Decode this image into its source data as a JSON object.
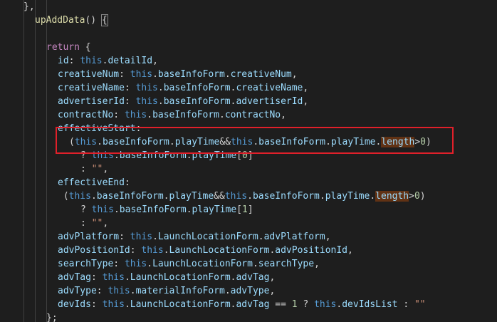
{
  "editor": {
    "colors": {
      "background": "#1e1e1e",
      "function": "#dcdcaa",
      "keyword": "#c586c0",
      "this": "#569cd6",
      "property": "#9cdcfe",
      "number": "#b5cea8",
      "string": "#ce9178",
      "punctuation": "#d4d4d4",
      "highlight_box": "#e0202a",
      "search_match": "#613214"
    },
    "lines": [
      {
        "indent": 0,
        "tokens": [
          {
            "t": "},",
            "c": "punc"
          }
        ]
      },
      {
        "indent": 1,
        "tokens": [
          {
            "t": "upAddData",
            "c": "fn"
          },
          {
            "t": "() ",
            "c": "punc"
          },
          {
            "t": "{",
            "c": "punc",
            "m": "brace-match"
          }
        ]
      },
      {
        "indent": 0,
        "tokens": []
      },
      {
        "indent": 2,
        "tokens": [
          {
            "t": "return",
            "c": "kw"
          },
          {
            "t": " {",
            "c": "punc"
          }
        ]
      },
      {
        "indent": 3,
        "tokens": [
          {
            "t": "id",
            "c": "prop"
          },
          {
            "t": ": ",
            "c": "punc"
          },
          {
            "t": "this",
            "c": "self"
          },
          {
            "t": ".",
            "c": "punc"
          },
          {
            "t": "detailId",
            "c": "prop"
          },
          {
            "t": ",",
            "c": "punc"
          }
        ]
      },
      {
        "indent": 3,
        "tokens": [
          {
            "t": "creativeNum",
            "c": "prop"
          },
          {
            "t": ": ",
            "c": "punc"
          },
          {
            "t": "this",
            "c": "self"
          },
          {
            "t": ".",
            "c": "punc"
          },
          {
            "t": "baseInfoForm",
            "c": "prop"
          },
          {
            "t": ".",
            "c": "punc"
          },
          {
            "t": "creativeNum",
            "c": "prop"
          },
          {
            "t": ",",
            "c": "punc"
          }
        ]
      },
      {
        "indent": 3,
        "tokens": [
          {
            "t": "creativeName",
            "c": "prop"
          },
          {
            "t": ": ",
            "c": "punc"
          },
          {
            "t": "this",
            "c": "self"
          },
          {
            "t": ".",
            "c": "punc"
          },
          {
            "t": "baseInfoForm",
            "c": "prop"
          },
          {
            "t": ".",
            "c": "punc"
          },
          {
            "t": "creativeName",
            "c": "prop"
          },
          {
            "t": ",",
            "c": "punc"
          }
        ]
      },
      {
        "indent": 3,
        "tokens": [
          {
            "t": "advertiserId",
            "c": "prop"
          },
          {
            "t": ": ",
            "c": "punc"
          },
          {
            "t": "this",
            "c": "self"
          },
          {
            "t": ".",
            "c": "punc"
          },
          {
            "t": "baseInfoForm",
            "c": "prop"
          },
          {
            "t": ".",
            "c": "punc"
          },
          {
            "t": "advertiserId",
            "c": "prop"
          },
          {
            "t": ",",
            "c": "punc"
          }
        ]
      },
      {
        "indent": 3,
        "tokens": [
          {
            "t": "contractNo",
            "c": "prop"
          },
          {
            "t": ": ",
            "c": "punc"
          },
          {
            "t": "this",
            "c": "self"
          },
          {
            "t": ".",
            "c": "punc"
          },
          {
            "t": "baseInfoForm",
            "c": "prop"
          },
          {
            "t": ".",
            "c": "punc"
          },
          {
            "t": "contractNo",
            "c": "prop"
          },
          {
            "t": ",",
            "c": "punc"
          }
        ]
      },
      {
        "indent": 3,
        "tokens": [
          {
            "t": "effectiveStart",
            "c": "prop"
          },
          {
            "t": ":",
            "c": "punc"
          }
        ]
      },
      {
        "indent": 4,
        "tokens": [
          {
            "t": "(",
            "c": "punc"
          },
          {
            "t": "this",
            "c": "self"
          },
          {
            "t": ".",
            "c": "punc"
          },
          {
            "t": "baseInfoForm",
            "c": "prop"
          },
          {
            "t": ".",
            "c": "punc"
          },
          {
            "t": "playTime",
            "c": "prop"
          },
          {
            "t": "&&",
            "c": "punc"
          },
          {
            "t": "this",
            "c": "self"
          },
          {
            "t": ".",
            "c": "punc"
          },
          {
            "t": "baseInfoForm",
            "c": "prop"
          },
          {
            "t": ".",
            "c": "punc"
          },
          {
            "t": "playTime",
            "c": "prop"
          },
          {
            "t": ".",
            "c": "punc"
          },
          {
            "t": "length",
            "c": "prop",
            "m": "hl"
          },
          {
            "t": ">",
            "c": "punc"
          },
          {
            "t": "0",
            "c": "num"
          },
          {
            "t": ")",
            "c": "punc"
          }
        ]
      },
      {
        "indent": 5,
        "tokens": [
          {
            "t": "? ",
            "c": "punc"
          },
          {
            "t": "this",
            "c": "self"
          },
          {
            "t": ".",
            "c": "punc"
          },
          {
            "t": "baseInfoForm",
            "c": "prop"
          },
          {
            "t": ".",
            "c": "punc"
          },
          {
            "t": "playTime",
            "c": "prop"
          },
          {
            "t": "[",
            "c": "punc"
          },
          {
            "t": "0",
            "c": "num"
          },
          {
            "t": "]",
            "c": "punc"
          }
        ]
      },
      {
        "indent": 5,
        "tokens": [
          {
            "t": ": ",
            "c": "punc"
          },
          {
            "t": "\"\"",
            "c": "str"
          },
          {
            "t": ",",
            "c": "punc"
          }
        ]
      },
      {
        "indent": 3,
        "tokens": [
          {
            "t": "effectiveEnd",
            "c": "prop"
          },
          {
            "t": ":",
            "c": "punc"
          }
        ]
      },
      {
        "indent": 3,
        "tokens": [
          {
            "t": " (",
            "c": "punc"
          },
          {
            "t": "this",
            "c": "self"
          },
          {
            "t": ".",
            "c": "punc"
          },
          {
            "t": "baseInfoForm",
            "c": "prop"
          },
          {
            "t": ".",
            "c": "punc"
          },
          {
            "t": "playTime",
            "c": "prop"
          },
          {
            "t": "&&",
            "c": "punc"
          },
          {
            "t": "this",
            "c": "self"
          },
          {
            "t": ".",
            "c": "punc"
          },
          {
            "t": "baseInfoForm",
            "c": "prop"
          },
          {
            "t": ".",
            "c": "punc"
          },
          {
            "t": "playTime",
            "c": "prop"
          },
          {
            "t": ".",
            "c": "punc"
          },
          {
            "t": "length",
            "c": "prop",
            "m": "hl"
          },
          {
            "t": ">",
            "c": "punc"
          },
          {
            "t": "0",
            "c": "num"
          },
          {
            "t": ")",
            "c": "punc"
          }
        ]
      },
      {
        "indent": 5,
        "tokens": [
          {
            "t": "? ",
            "c": "punc"
          },
          {
            "t": "this",
            "c": "self"
          },
          {
            "t": ".",
            "c": "punc"
          },
          {
            "t": "baseInfoForm",
            "c": "prop"
          },
          {
            "t": ".",
            "c": "punc"
          },
          {
            "t": "playTime",
            "c": "prop"
          },
          {
            "t": "[",
            "c": "punc"
          },
          {
            "t": "1",
            "c": "num"
          },
          {
            "t": "]",
            "c": "punc"
          }
        ]
      },
      {
        "indent": 5,
        "tokens": [
          {
            "t": ": ",
            "c": "punc"
          },
          {
            "t": "\"\"",
            "c": "str"
          },
          {
            "t": ",",
            "c": "punc"
          }
        ]
      },
      {
        "indent": 3,
        "tokens": [
          {
            "t": "advPlatform",
            "c": "prop"
          },
          {
            "t": ": ",
            "c": "punc"
          },
          {
            "t": "this",
            "c": "self"
          },
          {
            "t": ".",
            "c": "punc"
          },
          {
            "t": "LaunchLocationForm",
            "c": "prop"
          },
          {
            "t": ".",
            "c": "punc"
          },
          {
            "t": "advPlatform",
            "c": "prop"
          },
          {
            "t": ",",
            "c": "punc"
          }
        ]
      },
      {
        "indent": 3,
        "tokens": [
          {
            "t": "advPositionId",
            "c": "prop"
          },
          {
            "t": ": ",
            "c": "punc"
          },
          {
            "t": "this",
            "c": "self"
          },
          {
            "t": ".",
            "c": "punc"
          },
          {
            "t": "LaunchLocationForm",
            "c": "prop"
          },
          {
            "t": ".",
            "c": "punc"
          },
          {
            "t": "advPositionId",
            "c": "prop"
          },
          {
            "t": ",",
            "c": "punc"
          }
        ]
      },
      {
        "indent": 3,
        "tokens": [
          {
            "t": "searchType",
            "c": "prop"
          },
          {
            "t": ": ",
            "c": "punc"
          },
          {
            "t": "this",
            "c": "self"
          },
          {
            "t": ".",
            "c": "punc"
          },
          {
            "t": "LaunchLocationForm",
            "c": "prop"
          },
          {
            "t": ".",
            "c": "punc"
          },
          {
            "t": "searchType",
            "c": "prop"
          },
          {
            "t": ",",
            "c": "punc"
          }
        ]
      },
      {
        "indent": 3,
        "tokens": [
          {
            "t": "advTag",
            "c": "prop"
          },
          {
            "t": ": ",
            "c": "punc"
          },
          {
            "t": "this",
            "c": "self"
          },
          {
            "t": ".",
            "c": "punc"
          },
          {
            "t": "LaunchLocationForm",
            "c": "prop"
          },
          {
            "t": ".",
            "c": "punc"
          },
          {
            "t": "advTag",
            "c": "prop"
          },
          {
            "t": ",",
            "c": "punc"
          }
        ]
      },
      {
        "indent": 3,
        "tokens": [
          {
            "t": "advType",
            "c": "prop"
          },
          {
            "t": ": ",
            "c": "punc"
          },
          {
            "t": "this",
            "c": "self"
          },
          {
            "t": ".",
            "c": "punc"
          },
          {
            "t": "materialInfoForm",
            "c": "prop"
          },
          {
            "t": ".",
            "c": "punc"
          },
          {
            "t": "advType",
            "c": "prop"
          },
          {
            "t": ",",
            "c": "punc"
          }
        ]
      },
      {
        "indent": 3,
        "tokens": [
          {
            "t": "devIds",
            "c": "prop"
          },
          {
            "t": ": ",
            "c": "punc"
          },
          {
            "t": "this",
            "c": "self"
          },
          {
            "t": ".",
            "c": "punc"
          },
          {
            "t": "LaunchLocationForm",
            "c": "prop"
          },
          {
            "t": ".",
            "c": "punc"
          },
          {
            "t": "advTag",
            "c": "prop"
          },
          {
            "t": " == ",
            "c": "punc"
          },
          {
            "t": "1",
            "c": "num"
          },
          {
            "t": " ? ",
            "c": "punc"
          },
          {
            "t": "this",
            "c": "self"
          },
          {
            "t": ".",
            "c": "punc"
          },
          {
            "t": "devIdsList",
            "c": "prop"
          },
          {
            "t": " : ",
            "c": "punc"
          },
          {
            "t": "\"\"",
            "c": "str"
          }
        ]
      },
      {
        "indent": 2,
        "tokens": [
          {
            "t": "};",
            "c": "punc"
          }
        ]
      }
    ]
  }
}
